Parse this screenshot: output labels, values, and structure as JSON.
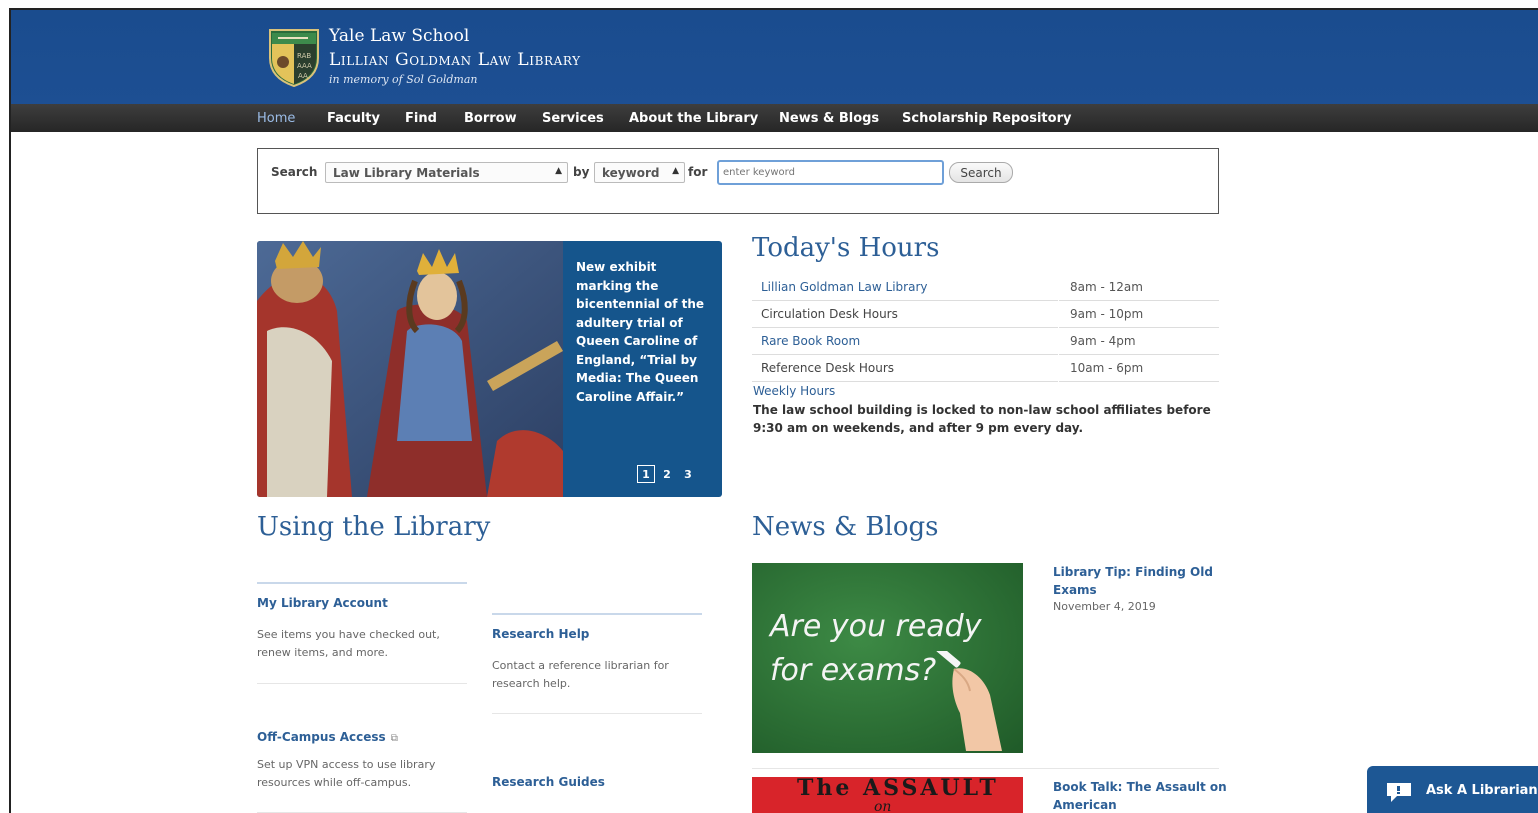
{
  "header": {
    "line1": "Yale Law School",
    "line2": "Lillian Goldman Law Library",
    "line3": "in memory of Sol Goldman"
  },
  "nav": {
    "items": [
      "Home",
      "Faculty",
      "Find",
      "Borrow",
      "Services",
      "About the Library",
      "News & Blogs",
      "Scholarship Repository"
    ],
    "active": "Home"
  },
  "search": {
    "label": "Search",
    "scope_value": "Law Library Materials",
    "by_label": "by",
    "field_value": "keyword",
    "for_label": "for",
    "placeholder": "enter keyword",
    "button": "Search"
  },
  "slider": {
    "caption": "New exhibit marking the bicentennial of the adultery trial of Queen Caroline of England, “Trial by Media: The Queen Caroline Affair.”",
    "pages": [
      "1",
      "2",
      "3"
    ],
    "current_page": "1"
  },
  "hours": {
    "title": "Today's Hours",
    "rows": [
      {
        "name": "Lillian Goldman Law Library",
        "time": "8am - 12am"
      },
      {
        "name": "Circulation Desk Hours",
        "time": "9am - 10pm"
      },
      {
        "name": "Rare Book Room",
        "time": "9am - 4pm"
      },
      {
        "name": "Reference Desk Hours",
        "time": "10am - 6pm"
      }
    ],
    "weekly_link": "Weekly Hours",
    "notice": "The law school building is locked to non-law school affiliates before 9:30 am on weekends, and after 9 pm every day."
  },
  "using": {
    "title": "Using the Library",
    "cards": [
      {
        "title": "My Library Account",
        "text": "See items you have checked out, renew items, and more."
      },
      {
        "title": "Research Help",
        "text": "Contact a reference librarian for research help."
      },
      {
        "title": "Off-Campus Access",
        "text": "Set up VPN access to use library resources while off-campus."
      },
      {
        "title": "Research Guides",
        "text": ""
      }
    ]
  },
  "news": {
    "title": "News & Blogs",
    "items": [
      {
        "title": "Library Tip: Finding Old Exams",
        "date": "November 4, 2019",
        "image_text_1": "Are you ready",
        "image_text_2": "for exams?"
      },
      {
        "title": "Book Talk: The Assault on American",
        "image_text_1": "The ASSAULT",
        "image_text_2": "on"
      }
    ]
  },
  "ask": {
    "label": "Ask A Librarian"
  },
  "colors": {
    "header_blue": "#1d4f93",
    "nav_dark": "#2e2e2e",
    "link_blue": "#2d5f96",
    "slider_blue": "#15558c"
  }
}
